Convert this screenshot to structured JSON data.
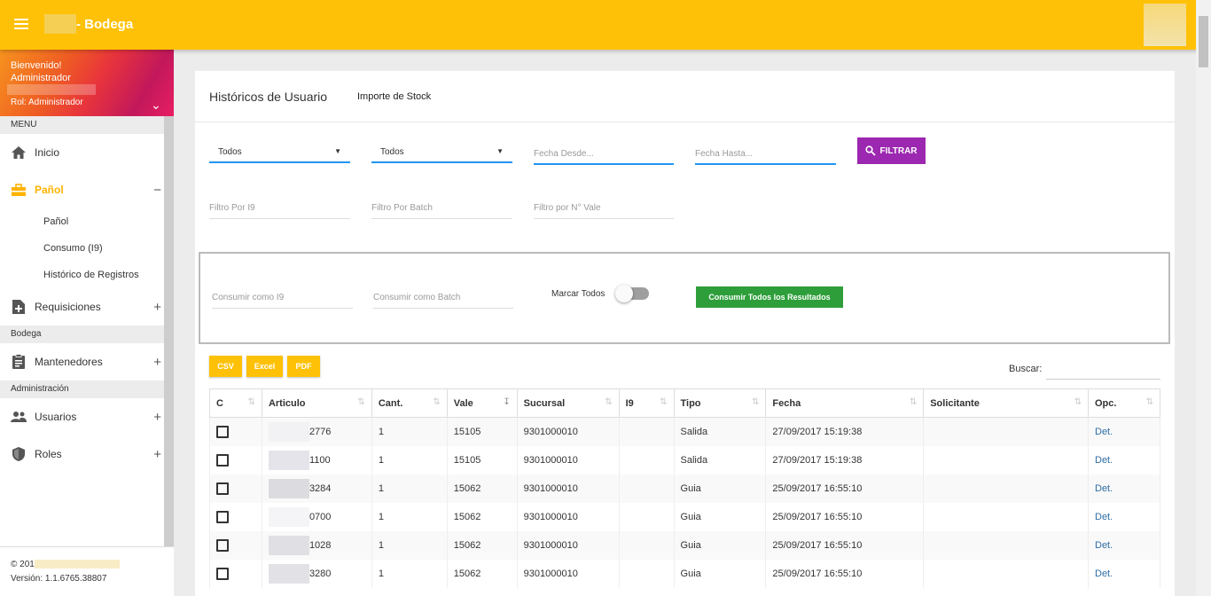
{
  "app": {
    "title": "- Bodega"
  },
  "sidebar": {
    "welcome": "Bienvenido!",
    "user": "Administrador",
    "role": "Rol: Administrador",
    "sections": [
      {
        "label": "MENU"
      },
      {
        "label": "Bodega"
      },
      {
        "label": "Administración"
      }
    ],
    "items": {
      "inicio": "Inicio",
      "panol": "Pañol",
      "panol_sub": [
        "Pañol",
        "Consumo (I9)",
        "Histórico de Registros"
      ],
      "requisiciones": "Requisiciones",
      "mantenedores": "Mantenedores",
      "usuarios": "Usuarios",
      "roles": "Roles"
    },
    "footer_copyright": "© 201",
    "footer_version": "Versión: 1.1.6765.38807"
  },
  "tabs": {
    "main": "Históricos de Usuario",
    "second": "Importe de Stock"
  },
  "filters": {
    "select1": "Todos",
    "select2": "Todos",
    "fecha_desde": "Fecha Desde...",
    "fecha_hasta": "Fecha Hasta...",
    "filter_button": "FILTRAR",
    "filtro_i9": "Filtro Por I9",
    "filtro_batch": "Filtro Por Batch",
    "filtro_vale": "Filtro por N° Vale"
  },
  "consume": {
    "como_i9": "Consumir como I9",
    "como_batch": "Consumir como Batch",
    "marcar_todos": "Marcar Todos",
    "marcar_todos_on": false,
    "button": "Consumir Todos los Resultados"
  },
  "export": {
    "csv": "CSV",
    "excel": "Excel",
    "pdf": "PDF"
  },
  "search": {
    "label": "Buscar:",
    "value": ""
  },
  "table": {
    "headers": [
      "C",
      "Articulo",
      "Cant.",
      "Vale",
      "Sucursal",
      "I9",
      "Tipo",
      "Fecha",
      "Solicitante",
      "Opc."
    ],
    "rows": [
      {
        "articulo": "2776",
        "cant": "1",
        "vale": "15105",
        "sucursal": "9301000010",
        "i9": "",
        "tipo": "Salida",
        "fecha": "27/09/2017 15:19:38",
        "solicitante": "",
        "opc": "Det."
      },
      {
        "articulo": "1100",
        "cant": "1",
        "vale": "15105",
        "sucursal": "9301000010",
        "i9": "",
        "tipo": "Salida",
        "fecha": "27/09/2017 15:19:38",
        "solicitante": "",
        "opc": "Det."
      },
      {
        "articulo": "3284",
        "cant": "1",
        "vale": "15062",
        "sucursal": "9301000010",
        "i9": "",
        "tipo": "Guia",
        "fecha": "25/09/2017 16:55:10",
        "solicitante": "",
        "opc": "Det."
      },
      {
        "articulo": "0700",
        "cant": "1",
        "vale": "15062",
        "sucursal": "9301000010",
        "i9": "",
        "tipo": "Guia",
        "fecha": "25/09/2017 16:55:10",
        "solicitante": "",
        "opc": "Det."
      },
      {
        "articulo": "1028",
        "cant": "1",
        "vale": "15062",
        "sucursal": "9301000010",
        "i9": "",
        "tipo": "Guia",
        "fecha": "25/09/2017 16:55:10",
        "solicitante": "",
        "opc": "Det."
      },
      {
        "articulo": "3280",
        "cant": "1",
        "vale": "15062",
        "sucursal": "9301000010",
        "i9": "",
        "tipo": "Guia",
        "fecha": "25/09/2017 16:55:10",
        "solicitante": "",
        "opc": "Det."
      }
    ]
  },
  "colors": {
    "accent": "#ffc107",
    "filter": "#9c27b0",
    "consume": "#2e9e3a",
    "active_menu": "#ffb300",
    "link": "#2e6da4"
  }
}
